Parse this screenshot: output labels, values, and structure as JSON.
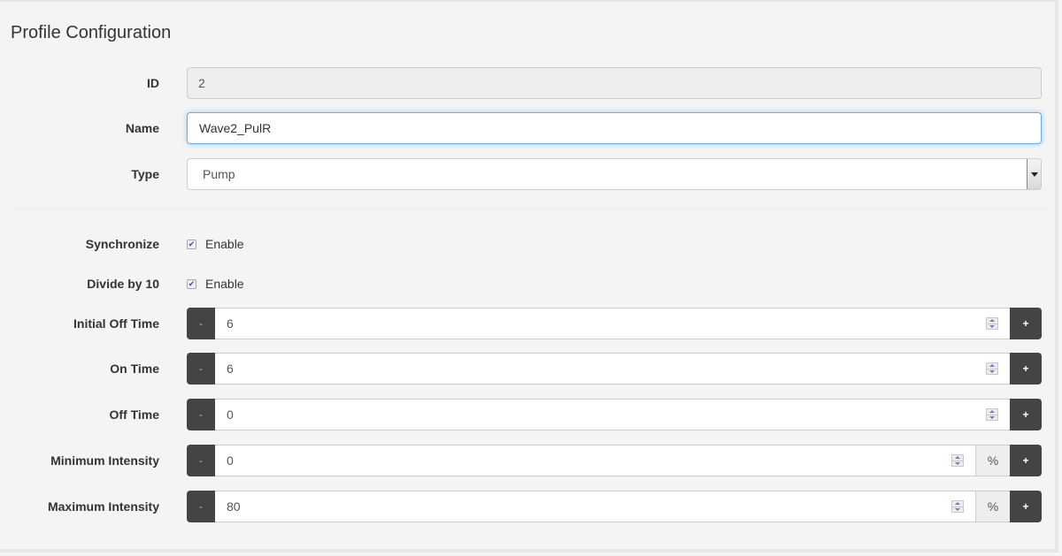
{
  "title": "Profile Configuration",
  "fields": {
    "id": {
      "label": "ID",
      "value": "2"
    },
    "name": {
      "label": "Name",
      "value": "Wave2_PulR"
    },
    "type": {
      "label": "Type",
      "selected": "Pump"
    }
  },
  "options": {
    "synchronize": {
      "label": "Synchronize",
      "checkbox_label": "Enable",
      "checked": true,
      "check_glyph": "✔"
    },
    "divide_by_10": {
      "label": "Divide by 10",
      "checkbox_label": "Enable",
      "checked": true,
      "check_glyph": "✔"
    }
  },
  "steppers": [
    {
      "label": "Initial Off Time",
      "value": "6",
      "minus": "-",
      "plus": "+",
      "unit": null
    },
    {
      "label": "On Time",
      "value": "6",
      "minus": "-",
      "plus": "+",
      "unit": null
    },
    {
      "label": "Off Time",
      "value": "0",
      "minus": "-",
      "plus": "+",
      "unit": null
    },
    {
      "label": "Minimum Intensity",
      "value": "0",
      "minus": "-",
      "plus": "+",
      "unit": "%"
    },
    {
      "label": "Maximum Intensity",
      "value": "80",
      "minus": "-",
      "plus": "+",
      "unit": "%"
    }
  ],
  "colors": {
    "button_dark": "#444444",
    "focus_border": "#66afe9",
    "background": "#f4f4f4"
  }
}
